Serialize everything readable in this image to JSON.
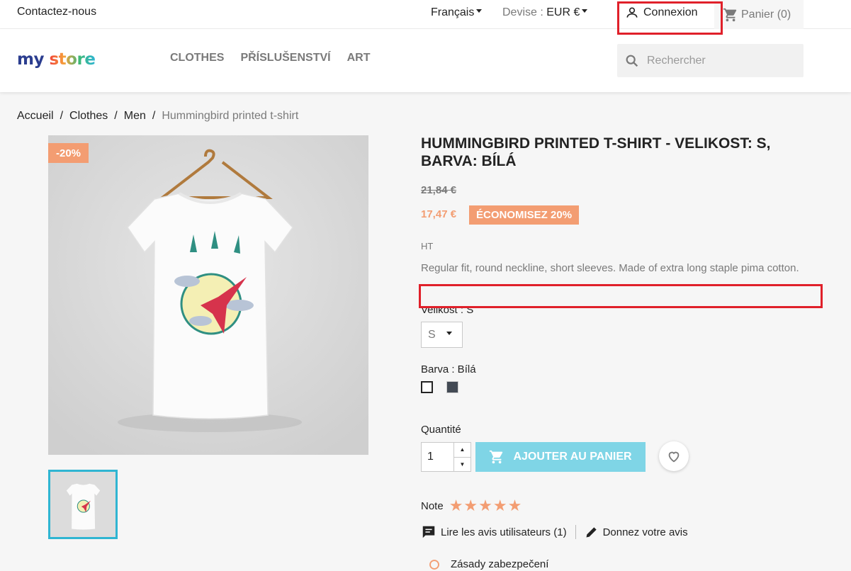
{
  "topbar": {
    "contact": "Contactez-nous",
    "language": "Français",
    "currency_label": "Devise :",
    "currency_value": "EUR €",
    "login": "Connexion",
    "cart": "Panier (0)"
  },
  "header": {
    "logo_part1": "my",
    "logo_part2": "store",
    "nav": [
      "CLOTHES",
      "PŘÍSLUŠENSTVÍ",
      "ART"
    ],
    "search_placeholder": "Rechercher"
  },
  "breadcrumb": [
    "Accueil",
    "Clothes",
    "Men",
    "Hummingbird printed t-shirt"
  ],
  "product": {
    "discount_flag": "-20%",
    "title": "Hummingbird printed t-shirt - Velikost: S, Barva: Bílá",
    "old_price": "21,84 €",
    "new_price": "17,47 €",
    "save_badge": "ÉCONOMISEZ 20%",
    "tax": "HT",
    "description": "Regular fit, round neckline, short sleeves. Made of extra long staple pima cotton.",
    "size_label": "Velikost : S",
    "size_value": "S",
    "color_label": "Barva : Bílá",
    "colors": [
      "#ffffff",
      "#434a54"
    ],
    "quantity_label": "Quantité",
    "quantity_value": "1",
    "add_to_cart": "AJOUTER AU PANIER",
    "rating_label": "Note",
    "rating_stars": "★★★★★",
    "rating_value": 5,
    "reviews_link": "Lire les avis utilisateurs (1)",
    "write_review": "Donnez votre avis",
    "policy": "Zásady zabezpečení"
  },
  "accent_colors": {
    "sale": "#f39d72",
    "primary": "#2fb5d2",
    "highlight": "#e0202a"
  }
}
